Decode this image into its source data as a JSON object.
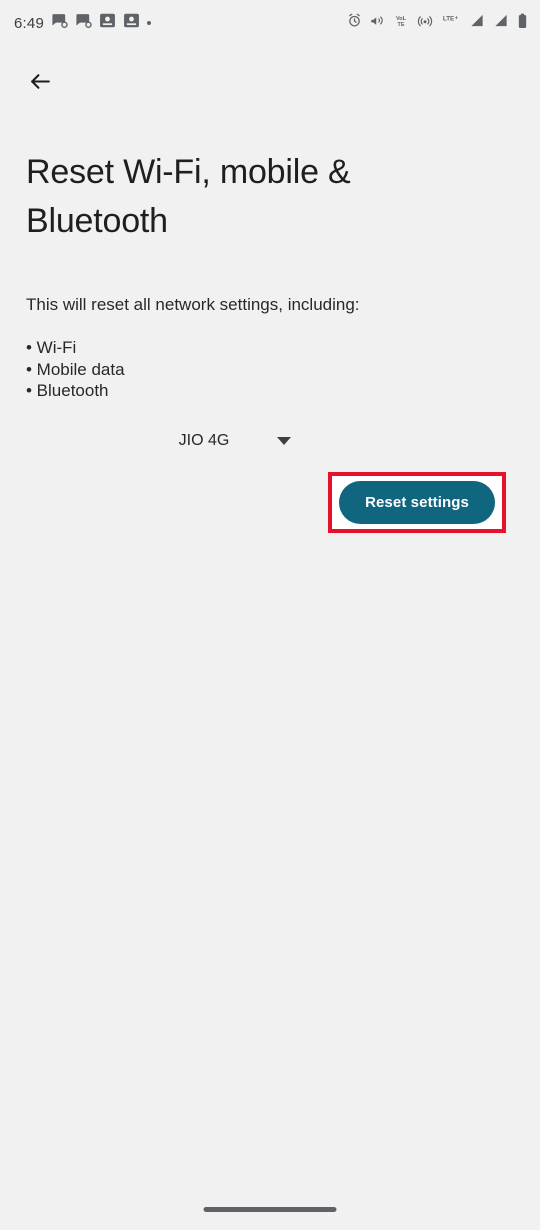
{
  "status_bar": {
    "time": "6:49",
    "left_icons": [
      {
        "name": "message-notification-icon"
      },
      {
        "name": "message-notification-icon"
      },
      {
        "name": "screenshot-notification-icon"
      },
      {
        "name": "screenshot-notification-icon"
      },
      {
        "name": "more-notifications-dot-icon"
      }
    ],
    "right_icons": [
      {
        "name": "alarm-icon"
      },
      {
        "name": "vibrate-icon"
      },
      {
        "name": "volte-icon",
        "label": "VoLTE"
      },
      {
        "name": "hotspot-icon"
      },
      {
        "name": "lte-plus-icon",
        "label": "LTE+"
      },
      {
        "name": "signal-bars-sim1-icon"
      },
      {
        "name": "signal-bars-sim2-icon"
      },
      {
        "name": "battery-icon"
      }
    ]
  },
  "appbar": {
    "back_label": "Back"
  },
  "main": {
    "title": "Reset Wi-Fi, mobile & Bluetooth",
    "intro": "This will reset all network settings, including:",
    "bullets": [
      "• Wi-Fi",
      "• Mobile data",
      "• Bluetooth"
    ],
    "sim_selector": {
      "value": "JIO 4G"
    },
    "reset_button": {
      "label": "Reset settings",
      "color": "#10657f",
      "text_color": "#ffffff",
      "highlight_color": "#e8112d"
    }
  },
  "theme": {
    "background": "#f1f1f1",
    "text": "#1f1f1f",
    "body_text": "#26282b"
  }
}
